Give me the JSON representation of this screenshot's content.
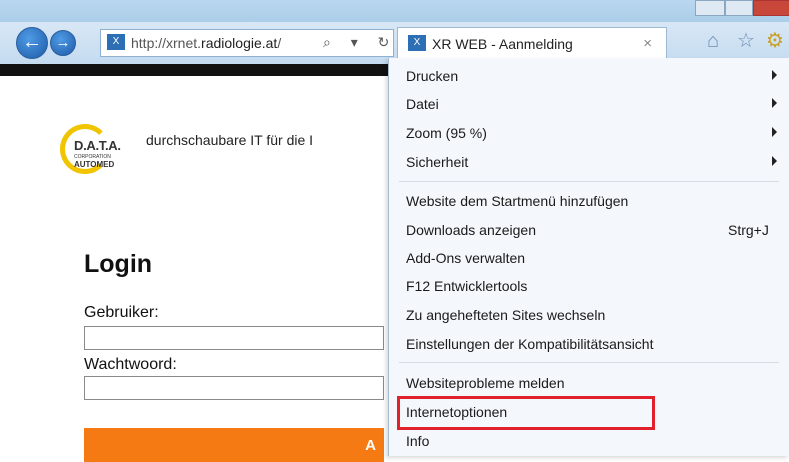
{
  "browser": {
    "nav": {
      "back": "←",
      "forward": "→"
    },
    "address": {
      "url_prefix": "http://xrnet.",
      "url_domain": "radiologie.at",
      "url_suffix": "/",
      "actions": "⌕ ▾ ↻"
    },
    "tab": {
      "title": "XR WEB - Aanmelding",
      "close": "×"
    },
    "icons": {
      "home": "⌂",
      "favorites": "☆",
      "tools": "⚙"
    }
  },
  "page": {
    "logo": {
      "line1": "D.A.T.A.",
      "line2": "CORPORATION",
      "line3": "AUTOMED"
    },
    "tagline": "durchschaubare IT für die I",
    "login_title": "Login",
    "username_label": "Gebruiker:",
    "password_label": "Wachtwoord:",
    "submit_partial": "A"
  },
  "menu": {
    "items": [
      {
        "label": "Drucken",
        "submenu": true
      },
      {
        "label": "Datei",
        "submenu": true
      },
      {
        "label": "Zoom (95 %)",
        "submenu": true
      },
      {
        "label": "Sicherheit",
        "submenu": true
      },
      {
        "label": "Website dem Startmenü hinzufügen"
      },
      {
        "label": "Downloads anzeigen",
        "shortcut": "Strg+J"
      },
      {
        "label": "Add-Ons verwalten"
      },
      {
        "label": "F12 Entwicklertools"
      },
      {
        "label": "Zu angehefteten Sites wechseln"
      },
      {
        "label": "Einstellungen der Kompatibilitätsansicht"
      },
      {
        "label": "Websiteprobleme melden"
      },
      {
        "label": "Internetoptionen",
        "highlighted": true
      },
      {
        "label": "Info"
      }
    ],
    "highlight_color": "#e0202a"
  }
}
